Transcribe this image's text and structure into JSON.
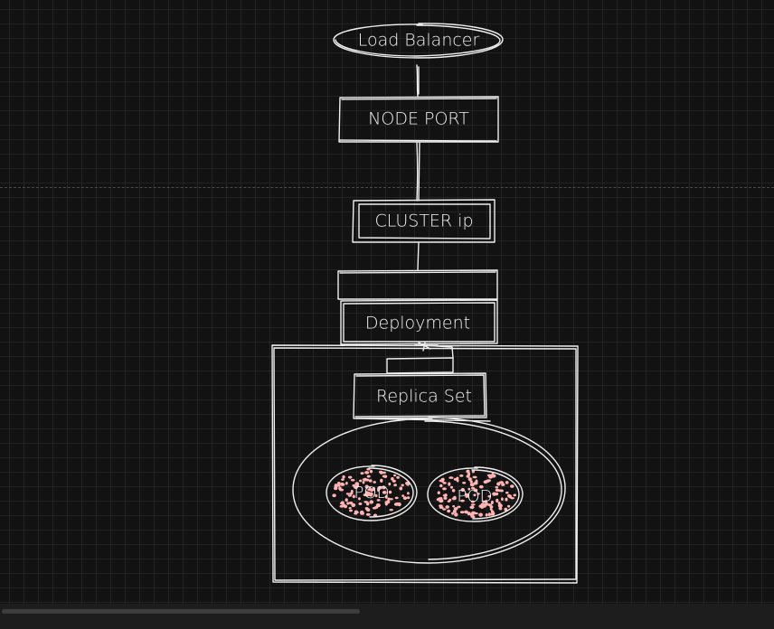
{
  "diagram": {
    "nodes": {
      "load_balancer": "Load Balancer",
      "node_port": "NODE PORT",
      "cluster_ip": "CLUSTER ip",
      "deployment": "Deployment",
      "replica_set": "Replica Set",
      "pod_1": "POD",
      "pod_2": "POD"
    }
  },
  "colors": {
    "background": "#121212",
    "grid": "#232323",
    "stroke": "#efefef",
    "pod_hachure": "#ffb3b3"
  }
}
